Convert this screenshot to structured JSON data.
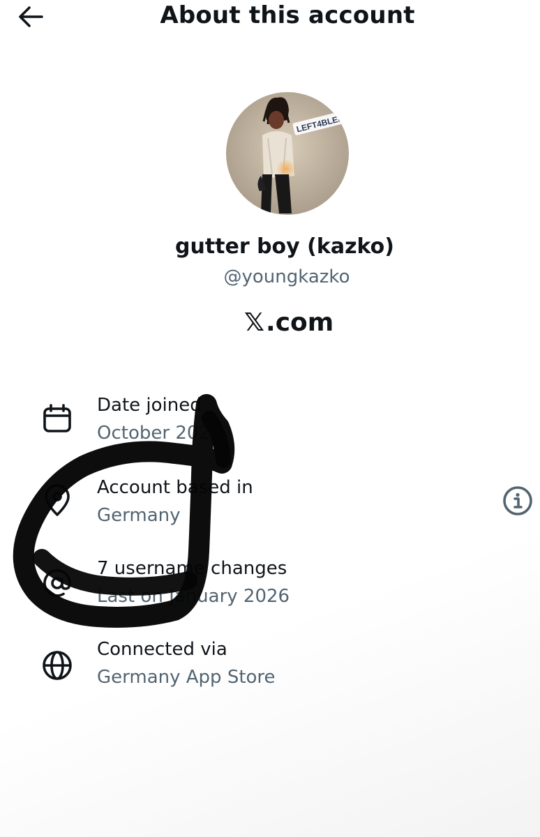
{
  "header": {
    "back_icon": "arrow-left-icon",
    "title": "About this account"
  },
  "profile": {
    "avatar_text": "LEFT4BLED",
    "display_name": "gutter boy (kazko)",
    "handle": "@youngkazko",
    "site_logo": "𝕏",
    "site_suffix": ".com"
  },
  "details": [
    {
      "icon": "calendar-icon",
      "label": "Date joined",
      "value": "October 2023"
    },
    {
      "icon": "location-pin-icon",
      "label": "Account based in",
      "value": "Germany"
    },
    {
      "icon": "at-sign-icon",
      "label": "7 username changes",
      "value": "Last on January 2026"
    },
    {
      "icon": "globe-icon",
      "label": "Connected via",
      "value": "Germany App Store"
    }
  ],
  "info_button": {
    "icon": "info-icon"
  },
  "colors": {
    "text": "#0f1419",
    "secondary": "#536471",
    "scribble": "#050505"
  }
}
